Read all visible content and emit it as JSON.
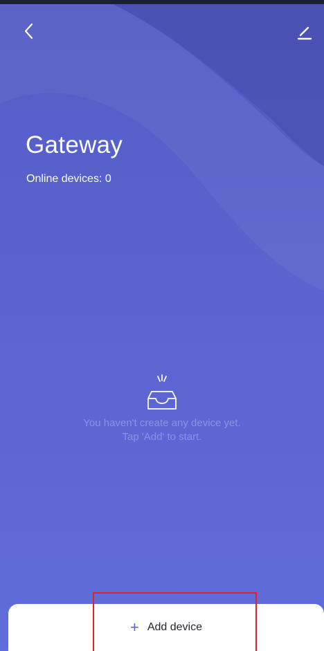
{
  "header": {
    "back_icon": "chevron-left-icon",
    "edit_icon": "edit-pencil-icon"
  },
  "page": {
    "title": "Gateway",
    "online_devices": "Online devices: 0"
  },
  "empty_state": {
    "icon": "empty-inbox-icon",
    "line1": "You haven't create any device yet.",
    "line2": "Tap 'Add' to start."
  },
  "footer": {
    "add_icon": "plus-icon",
    "add_symbol": "+",
    "add_label": "Add device"
  },
  "colors": {
    "background_top": "#5058c0",
    "background_bottom": "#6470e0",
    "accent": "#5a62d6",
    "highlight": "#e0202c"
  }
}
